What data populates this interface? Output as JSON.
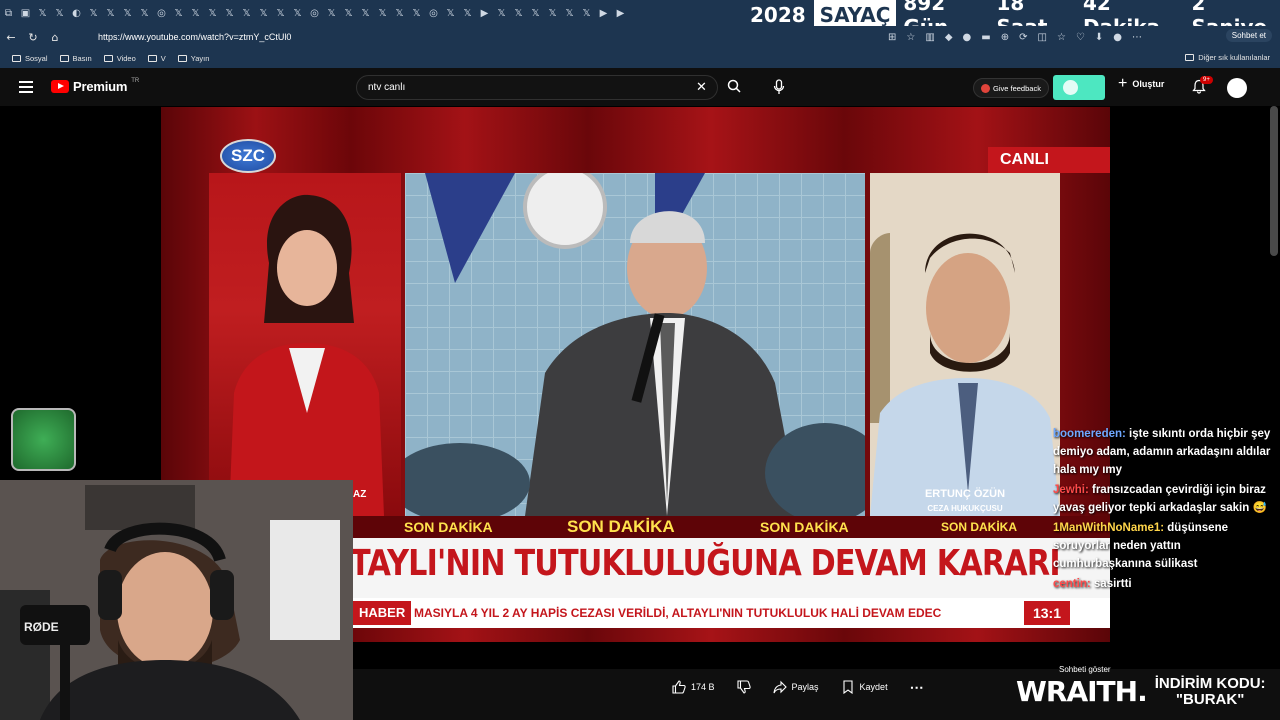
{
  "counter": {
    "year": "2028",
    "label": "SAYAÇ",
    "days": "892 Gün",
    "hours": "18 Saat",
    "minutes": "42 Dakika",
    "seconds": "2 Saniye"
  },
  "browser": {
    "url": "https://www.youtube.com/watch?v=ztmY_cCtUl0",
    "copilot": "Sohbet et",
    "bookmarks": [
      "Sosyal",
      "Basın",
      "Video",
      "V",
      "Yayın"
    ],
    "other_bookmarks": "Diğer sık kullanılanlar"
  },
  "youtube": {
    "logo": "Premium",
    "logo_sup": "TR",
    "search_value": "ntv canlı",
    "feedback": "Give feedback",
    "create": "Oluştur",
    "notif_badge": "9+"
  },
  "video": {
    "channel_logo": "SZC",
    "live": "CANLI",
    "left_frag": "AZ",
    "guest_name": "ERTUNÇ ÖZÜN",
    "guest_title": "CEZA HUKUKÇUSU",
    "breaking": [
      "SON DAKİKA",
      "SON DAKİKA",
      "SON DAKİKA",
      "SON DAKİKA"
    ],
    "headline": "TAYLI'NIN TUTUKLULUĞUNA DEVAM KARARI",
    "ticker_label": "HABER",
    "ticker": "MASIYLA 4 YIL 2 AY HAPİS CEZASI VERİLDİ, ALTAYLI'NIN TUTUKLULUK HALİ DEVAM EDEC",
    "time": "13:1"
  },
  "chat": [
    {
      "user": "boomereden:",
      "text": "işte sıkıntı orda hiçbir şey demiyo adam, adamın arkadaşını aldılar hala mıy ımy",
      "color": "blue"
    },
    {
      "user": "Jewhi:",
      "text": "fransızcadan çevirdiği için biraz yavaş geliyor tepki arkadaşlar sakin 😅",
      "color": "red"
    },
    {
      "user": "1ManWithNoName1:",
      "text": "düşünsene soruyorlar neden yattın cumhurbaşkanına sülikast",
      "color": "yel"
    },
    {
      "user": "centin:",
      "text": "sasirtti",
      "color": "red"
    }
  ],
  "actions": {
    "likes": "174 B",
    "share": "Paylaş",
    "save": "Kaydet",
    "chat_show": "Sohbeti göster"
  },
  "promo": {
    "brand": "WRAITH.",
    "code_label": "İNDİRİM KODU:",
    "code": "\"BURAK\""
  }
}
